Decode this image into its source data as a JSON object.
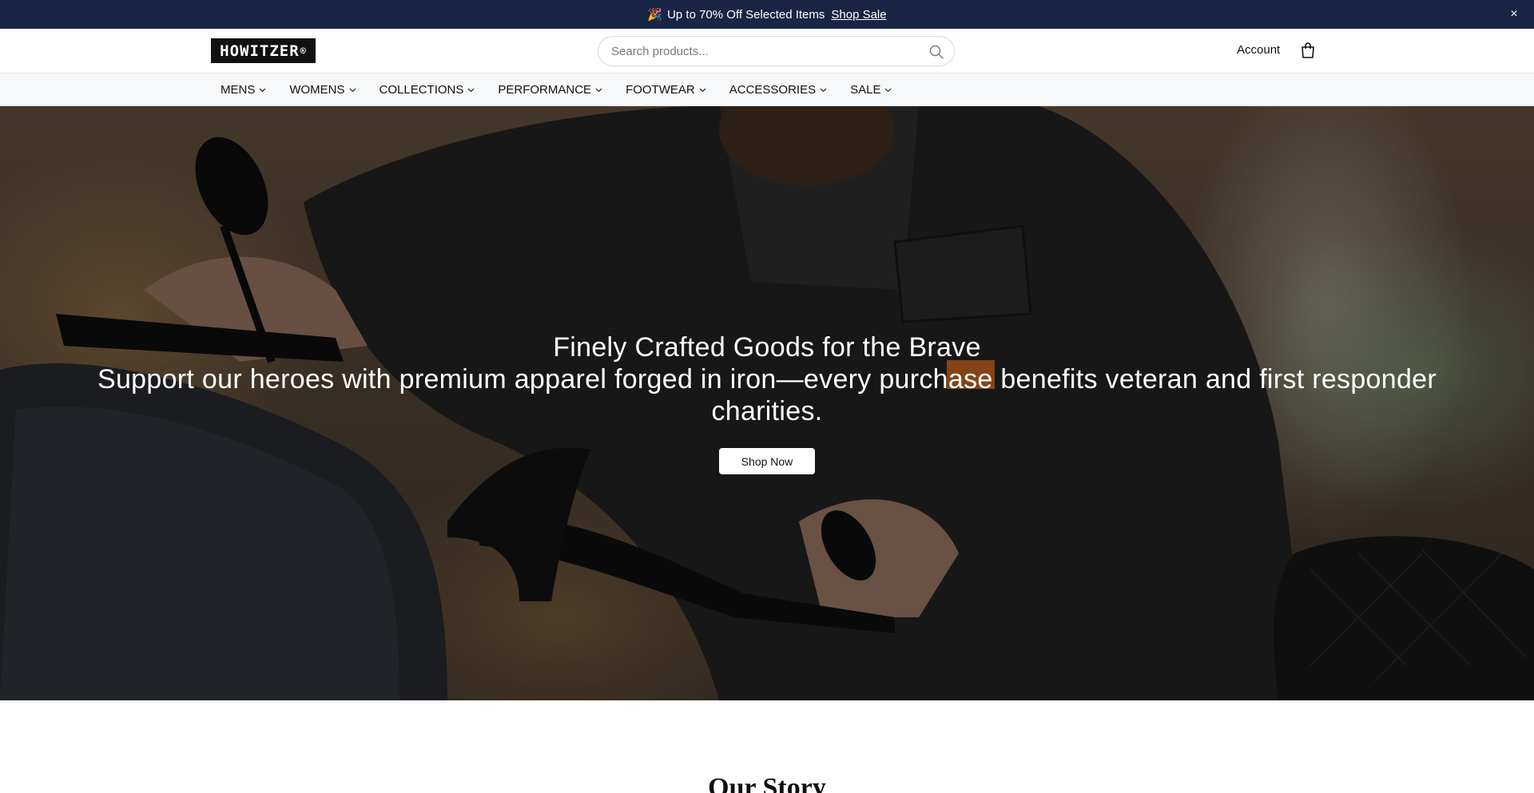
{
  "announcement": {
    "emoji": "🎉",
    "text": "Up to 70% Off Selected Items",
    "link": "Shop Sale",
    "close": "×"
  },
  "header": {
    "logo_text": "HOWITZER",
    "logo_mark": "®",
    "search_placeholder": "Search products...",
    "account_label": "Account",
    "icons": {
      "search": "search-icon",
      "cart": "shopping-bag-icon"
    }
  },
  "nav": {
    "items": [
      {
        "label": "MENS"
      },
      {
        "label": "WOMENS"
      },
      {
        "label": "COLLECTIONS"
      },
      {
        "label": "PERFORMANCE"
      },
      {
        "label": "FOOTWEAR"
      },
      {
        "label": "ACCESSORIES"
      },
      {
        "label": "SALE"
      }
    ]
  },
  "hero": {
    "title": "Finely Crafted Goods for the Brave",
    "subtitle": "Support our heroes with premium apparel forged in iron—every purchase benefits veteran and first responder charities.",
    "cta": "Shop Now"
  },
  "story": {
    "heading": "Our Story"
  },
  "colors": {
    "announcement_bg": "#182544",
    "nav_bg": "#f7f8f9",
    "button_bg": "#ffffff"
  }
}
